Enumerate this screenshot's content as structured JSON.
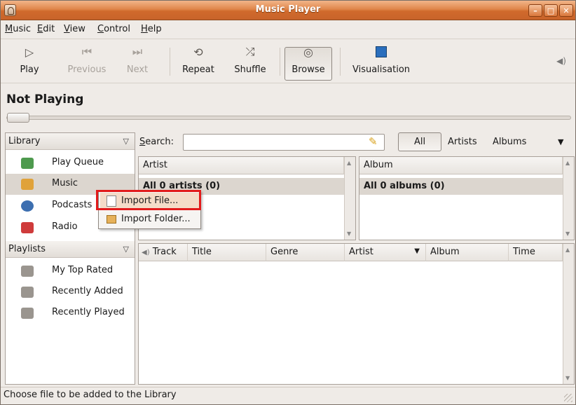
{
  "window": {
    "title": "Music Player"
  },
  "menubar": {
    "items": [
      "Music",
      "Edit",
      "View",
      "Control",
      "Help"
    ]
  },
  "toolbar": {
    "play": "Play",
    "previous": "Previous",
    "next": "Next",
    "repeat": "Repeat",
    "shuffle": "Shuffle",
    "browse": "Browse",
    "visualisation": "Visualisation"
  },
  "now_playing": "Not Playing",
  "library": {
    "header": "Library",
    "items": [
      {
        "label": "Play Queue",
        "icon": "play-queue-icon"
      },
      {
        "label": "Music",
        "icon": "music-icon"
      },
      {
        "label": "Podcasts",
        "icon": "podcasts-icon"
      },
      {
        "label": "Radio",
        "icon": "radio-icon"
      }
    ]
  },
  "playlists": {
    "header": "Playlists",
    "items": [
      {
        "label": "My Top Rated",
        "icon": "smart-playlist-icon"
      },
      {
        "label": "Recently Added",
        "icon": "smart-playlist-icon"
      },
      {
        "label": "Recently Played",
        "icon": "smart-playlist-icon"
      }
    ]
  },
  "search": {
    "label": "Search:",
    "value": ""
  },
  "filters": {
    "all": "All",
    "artists": "Artists",
    "albums": "Albums"
  },
  "browser": {
    "artist_header": "Artist",
    "artist_all": "All 0 artists (0)",
    "album_header": "Album",
    "album_all": "All 0 albums (0)"
  },
  "tracklist": {
    "columns": [
      "Track",
      "Title",
      "Genre",
      "Artist",
      "Album",
      "Time"
    ]
  },
  "context_menu": {
    "items": [
      "Import File...",
      "Import Folder..."
    ],
    "highlighted": "Import File..."
  },
  "status": "Choose file to be added to the Library",
  "colors": {
    "titlebar": "#d06a2c",
    "highlight_box": "#e21b1b",
    "selection": "#dcd6cf"
  }
}
